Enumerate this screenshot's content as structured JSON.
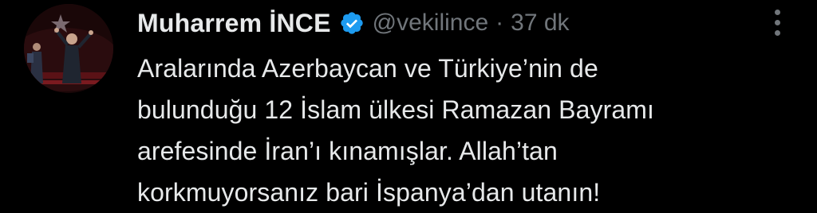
{
  "tweet": {
    "display_name": "Muharrem İNCE",
    "handle": "@vekilince",
    "separator": "·",
    "timestamp": "37 dk",
    "body": "Aralarında Azerbaycan ve Türkiye’nin de\nbulunduğu 12 İslam ülkesi Ramazan Bayramı\narefesinde İran’ı kınamışlar. Allah’tan\nkorkmuyorsanız bari İspanya’dan utanın!"
  },
  "icons": {
    "verified": "verified-badge-icon",
    "more": "more-options-icon"
  },
  "colors": {
    "background": "#000000",
    "text_primary": "#e7e9ea",
    "text_secondary": "#71767b",
    "verified_blue": "#1d9bf0"
  }
}
